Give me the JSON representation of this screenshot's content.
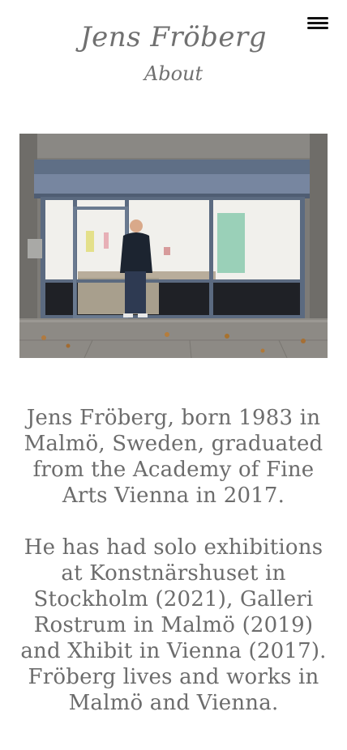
{
  "header": {
    "site_title": "Jens Fröberg",
    "page_title": "About",
    "menu_icon": "hamburger-menu-icon"
  },
  "photo": {
    "description": ""
  },
  "bio": {
    "paragraph_1": "Jens Fröberg, born 1983 in Malmö, Sweden, graduated from the Academy of Fine Arts Vienna in 2017.",
    "paragraph_2": "He has had solo exhibitions at Konstnärshuset in Stockholm (2021), Galleri Rostrum in Malmö (2019) and Xhibit in Vienna (2017). Fröberg lives and works in Malmö and Vienna."
  }
}
